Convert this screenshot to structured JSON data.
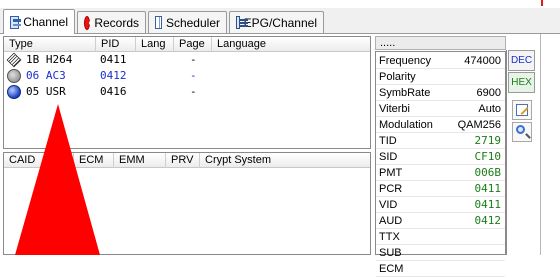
{
  "tabs": [
    {
      "label": "Channel",
      "icon": "channel-icon",
      "active": true
    },
    {
      "label": "Records",
      "icon": "record-icon",
      "active": false
    },
    {
      "label": "Scheduler",
      "icon": "scheduler-icon",
      "active": false
    },
    {
      "label": "EPG/Channel",
      "icon": "epg-icon",
      "active": false
    }
  ],
  "streams": {
    "columns": [
      "Type",
      "PID",
      "Lang",
      "Page",
      "Language"
    ],
    "rows": [
      {
        "type": "1B H264",
        "pid": "0411",
        "lang": "",
        "page": "-",
        "language": "",
        "icon": "video-stream-icon",
        "color": "#000000"
      },
      {
        "type": "06 AC3",
        "pid": "0412",
        "lang": "",
        "page": "-",
        "language": "",
        "icon": "audio-stream-icon",
        "color": "#1a2ecf"
      },
      {
        "type": "05 USR",
        "pid": "0416",
        "lang": "",
        "page": "-",
        "language": "",
        "icon": "user-stream-icon",
        "color": "#000000"
      }
    ]
  },
  "ca": {
    "columns": [
      "CAID",
      "ECM",
      "EMM",
      "PRV",
      "Crypt System"
    ]
  },
  "info": {
    "header": ".....",
    "rows": [
      {
        "key": "Frequency",
        "value": "474000",
        "hex": false
      },
      {
        "key": "Polarity",
        "value": "",
        "hex": false
      },
      {
        "key": "SymbRate",
        "value": "6900",
        "hex": false
      },
      {
        "key": "Viterbi",
        "value": "Auto",
        "hex": false
      },
      {
        "key": "Modulation",
        "value": "QAM256",
        "hex": false
      },
      {
        "key": "TID",
        "value": "2719",
        "hex": true
      },
      {
        "key": "SID",
        "value": "CF10",
        "hex": true
      },
      {
        "key": "PMT",
        "value": "006B",
        "hex": true
      },
      {
        "key": "PCR",
        "value": "0411",
        "hex": true
      },
      {
        "key": "VID",
        "value": "0411",
        "hex": true
      },
      {
        "key": "AUD",
        "value": "0412",
        "hex": true
      },
      {
        "key": "TTX",
        "value": "",
        "hex": false
      },
      {
        "key": "SUB",
        "value": "",
        "hex": false
      },
      {
        "key": "ECM",
        "value": "",
        "hex": false
      }
    ]
  },
  "side_buttons": {
    "dec": "DEC",
    "hex": "HEX"
  },
  "colors": {
    "accent_red": "#ff0000",
    "hex_green": "#1b7d14",
    "blue_text": "#1a2ecf"
  }
}
